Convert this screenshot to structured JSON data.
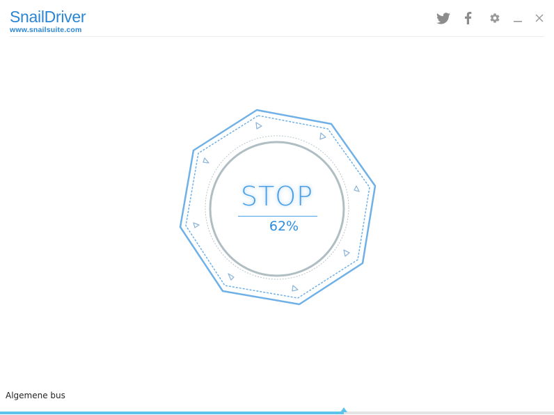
{
  "app": {
    "name": "SnailDriver",
    "url": "www.snailsuite.com"
  },
  "header": {
    "icons": [
      "twitter-icon",
      "facebook-icon",
      "gear-icon",
      "minimize-icon",
      "close-icon"
    ]
  },
  "dial": {
    "action_label": "STOP",
    "percent_label": "62%"
  },
  "status": {
    "current_item": "Algemene bus",
    "progress": 0.62
  },
  "colors": {
    "accent": "#4a9fe6",
    "brand": "#2a86d3",
    "progress": "#5cc3ea",
    "header_icons": "#8c8c8c"
  }
}
